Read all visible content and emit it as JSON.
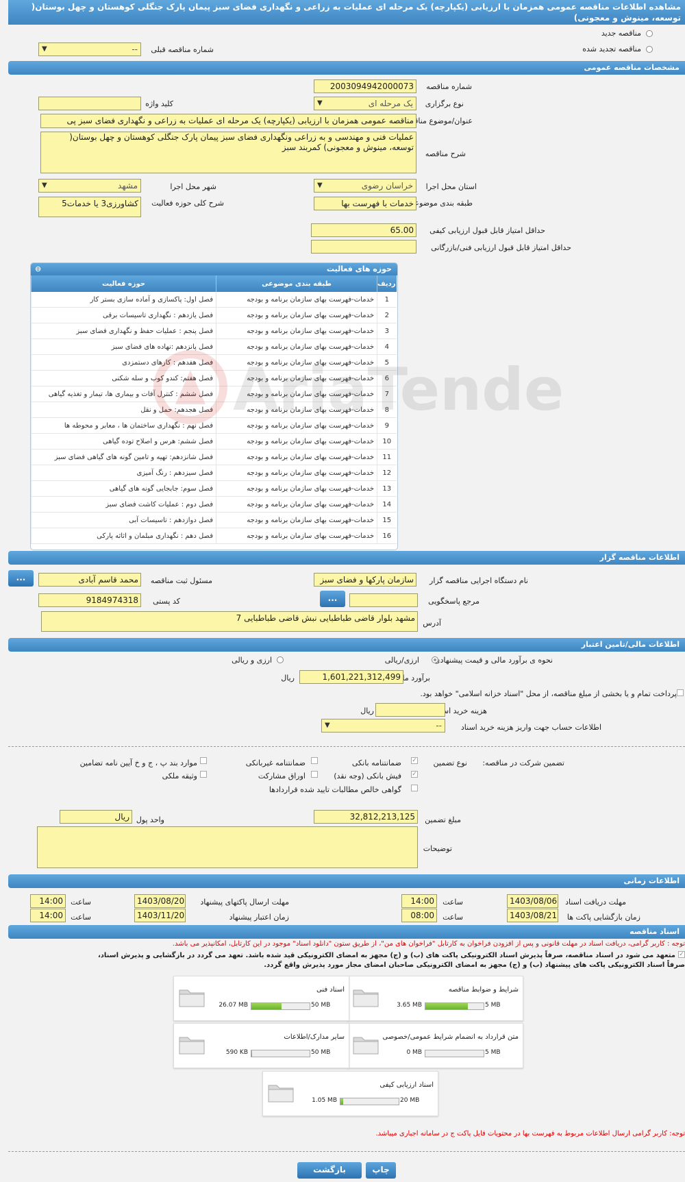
{
  "page_title": "مشاهده اطلاعات مناقصه عمومی همزمان با ارزیابی (یکپارچه) یک مرحله ای عملیات به زراعی و نگهداری فضای سبز پیمان پارک جنگلی کوهستان و چهل بوستان( توسعه، مینوش و معجونی)",
  "top": {
    "new_tender": "مناقصه جدید",
    "renewed_tender": "مناقصه تجدید شده",
    "prev_number_label": "شماره مناقصه قبلی",
    "prev_number_value": "--"
  },
  "general": {
    "section_title": "مشخصات مناقصه عمومی",
    "number_label": "شماره مناقصه",
    "number_value": "2003094942000073",
    "type_label": "نوع برگزاری",
    "type_value": "یک مرحله ای",
    "keyword_label": "کلید واژه",
    "keyword_value": "",
    "subject_label": "عنوان/موضوع مناقصه",
    "subject_value": "مناقصه عمومی همزمان با ارزیابی (یکپارچه) یک مرحله ای عملیات به زراعی و نگهداری فضای سبز پی",
    "description_label": "شرح مناقصه",
    "description_value": "عملیات فنی و مهندسی و به زراعی ونگهداری فضای سبز پیمان پارک جنگلی کوهستان و چهل بوستان( توسعه، مینوش و معجونی) کمربند سبز",
    "province_label": "استان محل اجرا",
    "province_value": "خراسان رضوی",
    "city_label": "شهر محل اجرا",
    "city_value": "مشهد",
    "category_label": "طبقه بندی موضوعی",
    "category_value": "خدمات با فهرست بها",
    "activity_desc_label": "شرح کلی حوزه فعالیت",
    "activity_desc_value": "کشاورزی3 یا خدمات5",
    "min_quality_label": "حداقل امتیاز قابل قبول ارزیابی کیفی",
    "min_quality_value": "65.00",
    "min_tech_label": "حداقل امتیاز قابل قبول ارزیابی فنی/بازرگانی",
    "min_tech_value": ""
  },
  "activity_grid": {
    "title": "حوزه های فعالیت",
    "col_row": "ردیف",
    "col_category": "طبقه بندی موضوعی",
    "col_activity": "حوزه فعالیت",
    "rows": [
      {
        "n": "1",
        "cat": "خدمات-فهرست بهای سازمان برنامه و بودجه",
        "act": "فصل اول:  پاکسازی و آماده سازی بستر کار"
      },
      {
        "n": "2",
        "cat": "خدمات-فهرست بهای سازمان برنامه و بودجه",
        "act": "فصل یازدهم : نگهداری تاسیسات برقی"
      },
      {
        "n": "3",
        "cat": "خدمات-فهرست بهای سازمان برنامه و بودجه",
        "act": "فصل پنجم : عملیات حفظ و نگهداری فضای سبز"
      },
      {
        "n": "4",
        "cat": "خدمات-فهرست بهای سازمان برنامه و بودجه",
        "act": "فصل پانزدهم :نهاده های فضای سبز"
      },
      {
        "n": "5",
        "cat": "خدمات-فهرست بهای سازمان برنامه و بودجه",
        "act": "فصل هفدهم : کارهای دستمزدی"
      },
      {
        "n": "6",
        "cat": "خدمات-فهرست بهای سازمان برنامه و بودجه",
        "act": "فصل هفتم: کندو کوب و سله شکنی"
      },
      {
        "n": "7",
        "cat": "خدمات-فهرست بهای سازمان برنامه و بودجه",
        "act": "فصل ششم : کنترل آفات و بیماری ها، تیمار و تغذیه گیاهی"
      },
      {
        "n": "8",
        "cat": "خدمات-فهرست بهای سازمان برنامه و بودجه",
        "act": "فصل هجدهم: حمل و نقل"
      },
      {
        "n": "9",
        "cat": "خدمات-فهرست بهای سازمان برنامه و بودجه",
        "act": "فصل نهم : نگهداری ساختمان ها ، معابر و محوطه ها"
      },
      {
        "n": "10",
        "cat": "خدمات-فهرست بهای سازمان برنامه و بودجه",
        "act": "فصل ششم: هرس و اصلاح توده گیاهی"
      },
      {
        "n": "11",
        "cat": "خدمات-فهرست بهای سازمان برنامه و بودجه",
        "act": "فصل شانزدهم: تهیه و تامین گونه های گیاهی فضای سبز"
      },
      {
        "n": "12",
        "cat": "خدمات-فهرست بهای سازمان برنامه و بودجه",
        "act": "فصل سیزدهم : رنگ آمیزی"
      },
      {
        "n": "13",
        "cat": "خدمات-فهرست بهای سازمان برنامه و بودجه",
        "act": "فصل سوم: جابجایی گونه های گیاهی"
      },
      {
        "n": "14",
        "cat": "خدمات-فهرست بهای سازمان برنامه و بودجه",
        "act": "فصل دوم : عملیات کاشت فضای سبز"
      },
      {
        "n": "15",
        "cat": "خدمات-فهرست بهای سازمان برنامه و بودجه",
        "act": "فصل دوازدهم : تاسیسات آبی"
      },
      {
        "n": "16",
        "cat": "خدمات-فهرست بهای سازمان برنامه و بودجه",
        "act": "فصل دهم : نگهداری مبلمان و اثاثه پارکی"
      }
    ]
  },
  "organizer": {
    "section_title": "اطلاعات مناقصه گزار",
    "org_label": "نام دستگاه اجرایی مناقصه گزار",
    "org_value": "سازمان پارکها و فضای سبز",
    "officer_label": "مسئول ثبت مناقصه",
    "officer_value": "محمد قاسم آبادی",
    "ref_label": "مرجع پاسخگویی",
    "ref_value": "",
    "postal_label": "کد پستی",
    "postal_value": "9184974318",
    "address_label": "آدرس",
    "address_value": "مشهد بلوار قاضی طباطبایی  نبش قاضی طباطبایی 7",
    "btn_dots": "..."
  },
  "finance": {
    "section_title": "اطلاعات مالی/تامین اعتبار",
    "method_label": "نحوه ی برآورد مالی و قیمت پیشنهادی",
    "opt_currency": "ارزی/ریالی",
    "opt_rial": "ارزی و ریالی",
    "estimate_label": "برآورد مالی",
    "estimate_value": "1,601,221,312,499",
    "rial": "ریال",
    "treasury_note": "پرداخت تمام و یا بخشی از مبلغ مناقصه، از محل \"اسناد خزانه اسلامی\" خواهد بود.",
    "doc_cost_label": "هزینه خرید اسناد",
    "doc_cost_value": "",
    "account_label": "اطلاعات حساب جهت واریز هزینه خرید اسناد",
    "account_value": "--"
  },
  "guarantee": {
    "title": "تضمین شرکت در مناقصه:",
    "type_label": "نوع تضمین",
    "opts": [
      "ضمانتنامه بانکی",
      "ضمانتنامه غیربانکی",
      "موارد بند پ ، ج و خ آیین نامه تضامین",
      "فیش بانکی (وجه نقد)",
      "اوراق مشارکت",
      "وثیقه ملکی",
      "گواهی خالص مطالبات تایید شده قراردادها"
    ],
    "amount_label": "مبلغ تضمین",
    "amount_value": "32,812,213,125",
    "currency_label": "واحد پول",
    "currency_value": "ریال",
    "notes_label": "توضیحات",
    "notes_value": ""
  },
  "timing": {
    "section_title": "اطلاعات زمانی",
    "receive_label": "مهلت دریافت اسناد",
    "receive_date": "1403/08/06",
    "receive_time": "14:00",
    "submit_label": "مهلت ارسال پاکتهای پیشنهاد",
    "submit_date": "1403/08/20",
    "submit_time": "14:00",
    "open_label": "زمان بازگشایی پاکت ها",
    "open_date": "1403/08/21",
    "open_time": "08:00",
    "validity_label": "زمان اعتبار پیشنهاد",
    "validity_date": "1403/11/20",
    "validity_time": "14:00",
    "time_label": "ساعت"
  },
  "documents": {
    "section_title": "اسناد مناقصه",
    "note1": "توجه : کاربر گرامی، دریافت اسناد در مهلت قانونی و پس از افزودن فراخوان به کارتابل \"فراخوان های من\"، از طریق ستون \"دانلود اسناد\" موجود در این کارتابل، امکانپذیر می باشد.",
    "commit1": "متعهد می شود در اسناد مناقصه، صرفاً پذیرش اسناد الکترونیکی پاکت های (ب) و (ج) مجهز به امضای الکترونیکی قید شده باشد. تعهد می گردد در بازگشایی و پذیرش اسناد،",
    "commit2": "صرفاً اسناد الکترونیکی پاکت های پیشنهاد (ب) و (ج) مجهز به امضای الکترونیکی صاحبان امضای مجاز مورد پذیرش واقع گردد.",
    "files": [
      {
        "name": "شرایط و ضوابط مناقصه",
        "size": "3.65 MB",
        "max": "5 MB",
        "pct": 0.73
      },
      {
        "name": "اسناد فنی",
        "size": "26.07 MB",
        "max": "50 MB",
        "pct": 0.52
      },
      {
        "name": "متن قرارداد به انضمام شرایط عمومی/خصوصی",
        "size": "0 MB",
        "max": "5 MB",
        "pct": 0.0
      },
      {
        "name": "سایر مدارک/اطلاعات",
        "size": "590 KB",
        "max": "50 MB",
        "pct": 0.012
      },
      {
        "name": "اسناد ارزیابی کیفی",
        "size": "1.05 MB",
        "max": "20 MB",
        "pct": 0.05
      }
    ],
    "note2": "توجه: کاربر گرامی ارسال اطلاعات مربوط به فهرست بها در محتویات فایل پاکت ج در سامانه اجباری میباشد."
  },
  "footer": {
    "print": "چاپ",
    "back": "بازگشت"
  },
  "watermark": "AriaTender.neT",
  "colors": {
    "header_blue": "#3f86c2",
    "input_yellow": "#fbf6a8",
    "progress_green": "#6ab22c"
  }
}
